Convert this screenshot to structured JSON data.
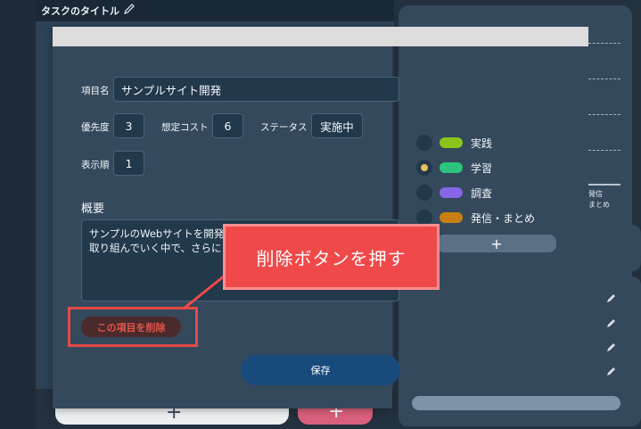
{
  "header": {
    "task_title": "タスクのタイトル"
  },
  "form": {
    "item_name_label": "項目名",
    "item_name_value": "サンプルサイト開発",
    "priority_label": "優先度",
    "priority_value": "3",
    "estimated_cost_label": "想定コスト",
    "estimated_cost_value": "6",
    "status_label": "ステータス",
    "status_value": "実施中",
    "display_order_label": "表示順",
    "display_order_value": "1",
    "overview_title": "概要",
    "overview_line1": "サンプルのWebサイトを開発",
    "overview_line2": "取り組んでいく中で、さらに",
    "delete_label": "この項目を削除",
    "save_label": "保存"
  },
  "statuses": [
    {
      "label": "実践",
      "color": "#8cc51a",
      "selected": false
    },
    {
      "label": "学習",
      "color": "#2bc47c",
      "selected": true
    },
    {
      "label": "調査",
      "color": "#8466e6",
      "selected": false
    },
    {
      "label": "発信・まとめ",
      "color": "#c77f12",
      "selected": false
    }
  ],
  "add_status_label": "+",
  "side": {
    "text1": "発信",
    "text2": "まとめ"
  },
  "bottom": {
    "plus_left": "+",
    "plus_right": "+"
  },
  "callout": {
    "text": "削除ボタンを押す"
  },
  "colors": {
    "accent_red": "#f0494a",
    "save_blue": "#184b7c",
    "panel": "#35495d"
  }
}
